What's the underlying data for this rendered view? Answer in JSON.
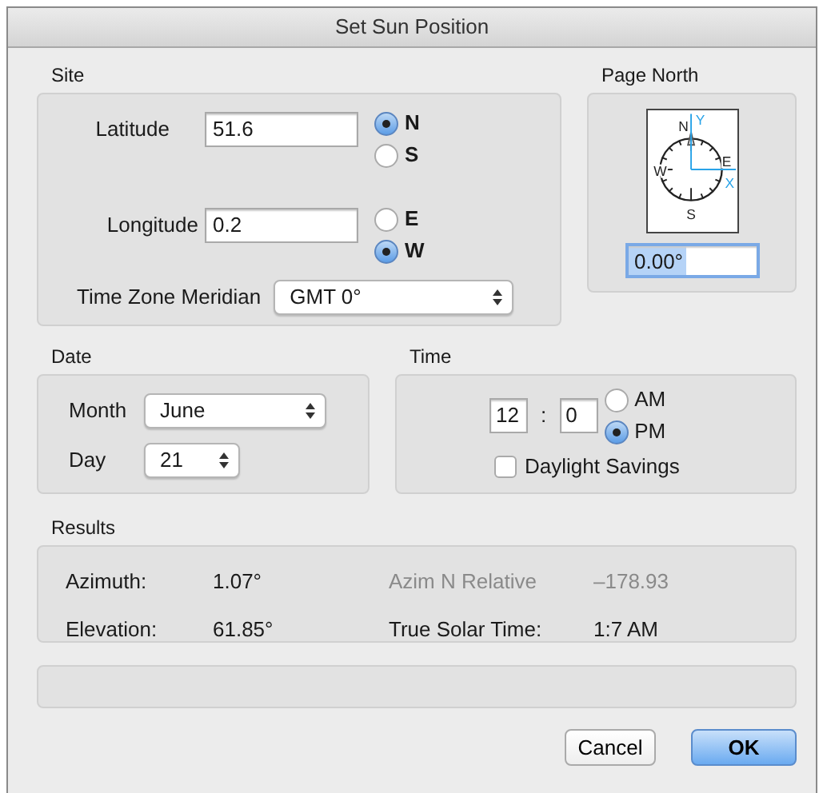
{
  "window": {
    "title": "Set Sun Position"
  },
  "site": {
    "title": "Site",
    "latitude": {
      "label": "Latitude",
      "value": "51.6",
      "options": [
        {
          "label": "N",
          "selected": true
        },
        {
          "label": "S",
          "selected": false
        }
      ]
    },
    "longitude": {
      "label": "Longitude",
      "value": "0.2",
      "options": [
        {
          "label": "E",
          "selected": false
        },
        {
          "label": "W",
          "selected": true
        }
      ]
    },
    "time_zone": {
      "label": "Time Zone Meridian",
      "value": "GMT 0°"
    }
  },
  "page_north": {
    "title": "Page North",
    "compass_labels": {
      "north": "N",
      "east": "E",
      "south": "S",
      "west": "W",
      "x_axis": "X",
      "y_axis": "Y"
    },
    "value": "0.00°",
    "focused": true
  },
  "date": {
    "title": "Date",
    "month": {
      "label": "Month",
      "value": "June"
    },
    "day": {
      "label": "Day",
      "value": "21"
    }
  },
  "time": {
    "title": "Time",
    "hour": "12",
    "separator": ":",
    "minute": "0",
    "options": [
      {
        "label": "AM",
        "selected": false
      },
      {
        "label": "PM",
        "selected": true
      }
    ],
    "daylight_savings": {
      "label": "Daylight Savings",
      "checked": false
    }
  },
  "results": {
    "title": "Results",
    "items": [
      {
        "label": "Azimuth:",
        "value": "1.07°",
        "disabled": false
      },
      {
        "label": "Azim N Relative",
        "value": "–178.93",
        "disabled": true
      },
      {
        "label": "Elevation:",
        "value": "61.85°",
        "disabled": false
      },
      {
        "label": "True Solar Time:",
        "value": "1:7 AM",
        "disabled": false
      }
    ]
  },
  "buttons": [
    {
      "label": "Cancel",
      "default": false
    },
    {
      "label": "OK",
      "default": true
    }
  ]
}
